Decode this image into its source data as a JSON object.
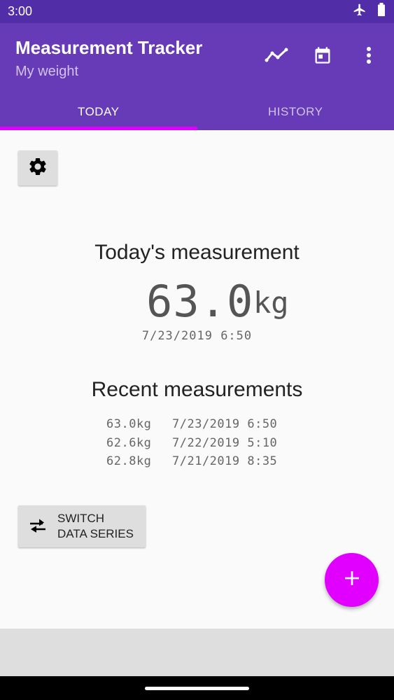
{
  "status_bar": {
    "time": "3:00",
    "icons": [
      "airplane-icon",
      "battery-icon"
    ]
  },
  "app_bar": {
    "title": "Measurement Tracker",
    "subtitle": "My weight",
    "actions": [
      "chart-icon",
      "calendar-icon",
      "more-vert-icon"
    ]
  },
  "tabs": [
    {
      "label": "TODAY",
      "active": true
    },
    {
      "label": "HISTORY",
      "active": false
    }
  ],
  "today": {
    "heading": "Today's measurement",
    "value": "63.0",
    "unit": "kg",
    "datetime": "7/23/2019 6:50"
  },
  "recent": {
    "heading": "Recent measurements",
    "items": [
      {
        "value": "63.0kg",
        "datetime": "7/23/2019 6:50"
      },
      {
        "value": "62.6kg",
        "datetime": "7/22/2019 5:10"
      },
      {
        "value": "62.8kg",
        "datetime": "7/21/2019 8:35"
      }
    ]
  },
  "switch_button": {
    "line1": "SWITCH",
    "line2": "DATA SERIES"
  },
  "colors": {
    "status_bar": "#512da8",
    "primary": "#673ab7",
    "accent": "#e100ff",
    "background": "#fafafa"
  }
}
